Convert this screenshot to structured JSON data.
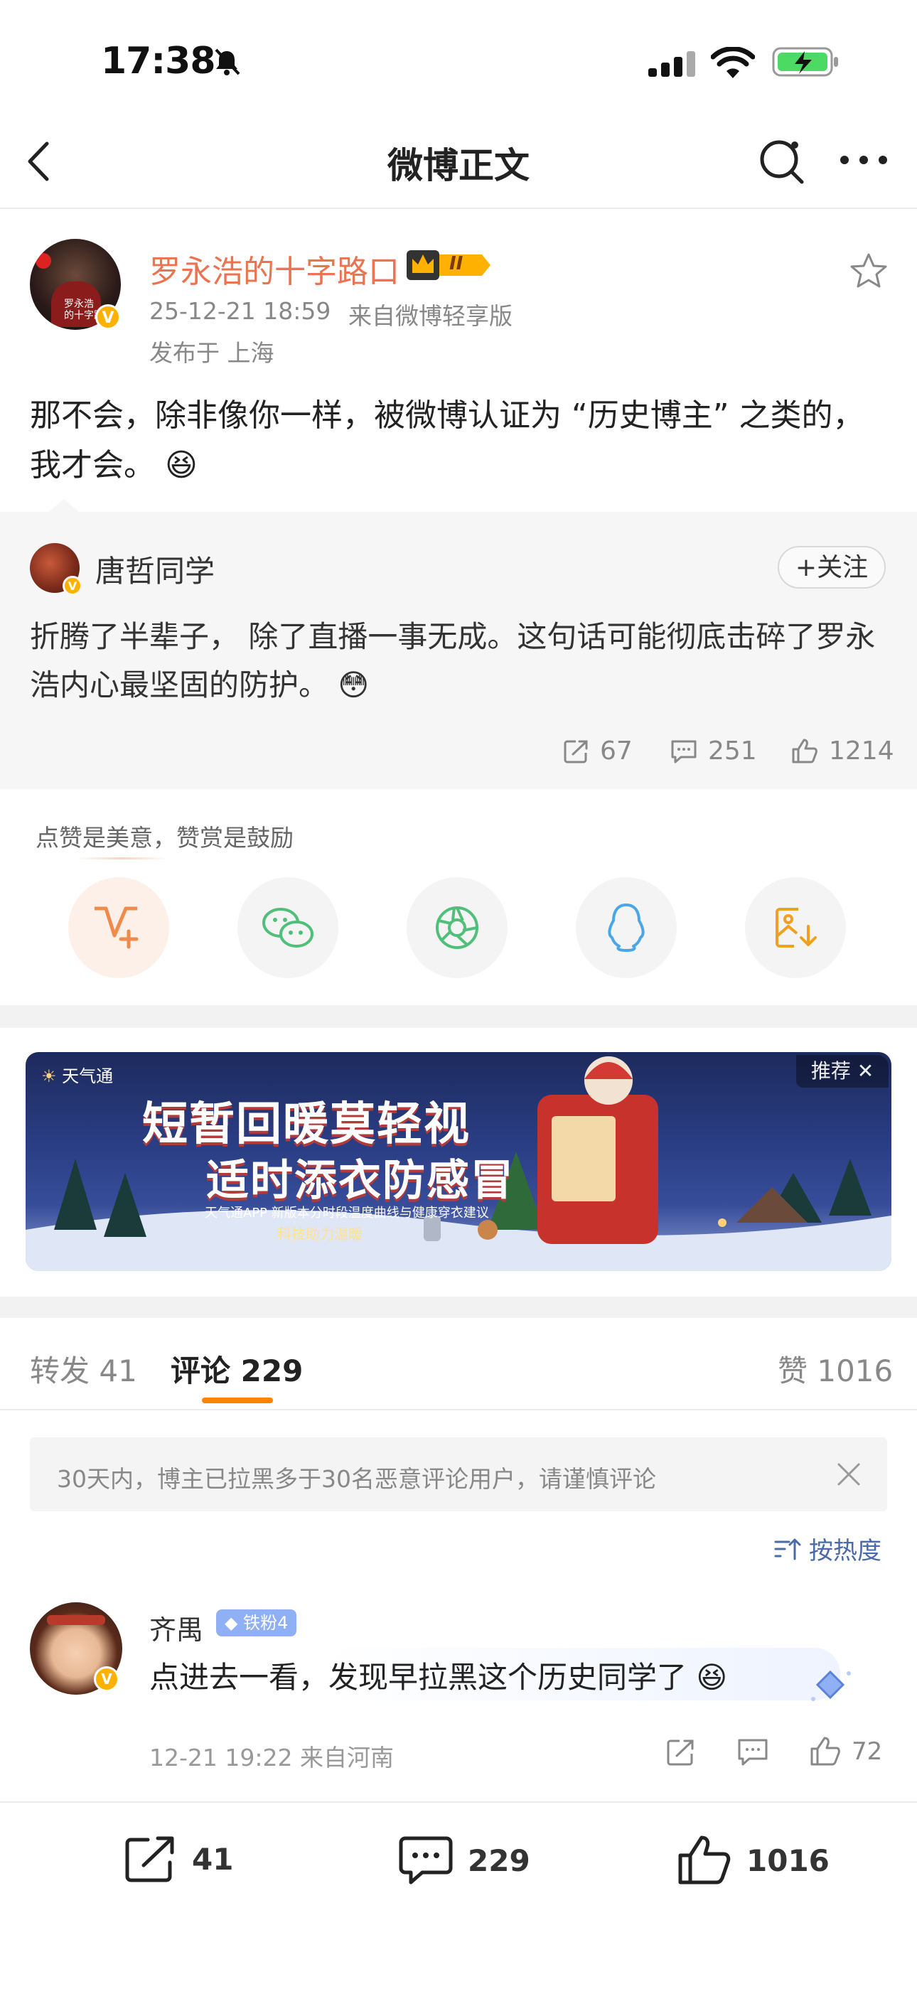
{
  "status_bar": {
    "time": "17:38"
  },
  "nav": {
    "title": "微博正文"
  },
  "post": {
    "author": "罗永浩的十字路口",
    "avatar_caption": "罗永浩\n的十字路口",
    "timestamp": "25-12-21 18:59",
    "source": "来自微博轻享版",
    "location": "发布于 上海",
    "text": "那不会，除非像你一样，被微博认证为 “历史博主” 之类的，我才会。",
    "emoji": "😆",
    "vip_badge": "II"
  },
  "quoted": {
    "author": "唐哲同学",
    "follow_label": "+关注",
    "text": "折腾了半辈子， 除了直播一事无成。这句话可能彻底击碎了罗永浩内心最坚固的防护。",
    "emoji": "😳",
    "reposts": "67",
    "comments": "251",
    "likes": "1214"
  },
  "share": {
    "hint": "点赞是美意，赞赏是鼓励",
    "items": [
      {
        "name": "reward",
        "color": "#f08a4b"
      },
      {
        "name": "wechat",
        "color": "#4fbf7a"
      },
      {
        "name": "moments",
        "color": "#4fbf7a"
      },
      {
        "name": "qq",
        "color": "#4aa6e6"
      },
      {
        "name": "save-image",
        "color": "#f0a020"
      }
    ]
  },
  "ad": {
    "brand": "天气通",
    "tag": "推荐 ✕",
    "line1": "短暂回暖莫轻视",
    "line2": "适时添衣防感冒",
    "sub": "天气通APP 新版本分时段温度曲线与健康穿衣建议",
    "sub2": "科技助力温暖"
  },
  "tabs": {
    "repost": "转发 41",
    "comment": "评论 229",
    "like": "赞 1016"
  },
  "notice": {
    "text": "30天内，博主已拉黑多于30名恶意评论用户，请谨慎评论"
  },
  "sort": {
    "label": "按热度"
  },
  "comment": {
    "author": "齐禺",
    "badge": "铁粉4",
    "text": "点进去一看，发现早拉黑这个历史同学了",
    "emoji": "😆",
    "meta": "12-21 19:22 来自河南",
    "likes": "72"
  },
  "bottom_bar": {
    "reposts": "41",
    "comments": "229",
    "likes": "1016"
  },
  "colors": {
    "accent_orange": "#ff8200",
    "author_orange": "#eb7350",
    "link_blue": "#4a6aa8"
  }
}
